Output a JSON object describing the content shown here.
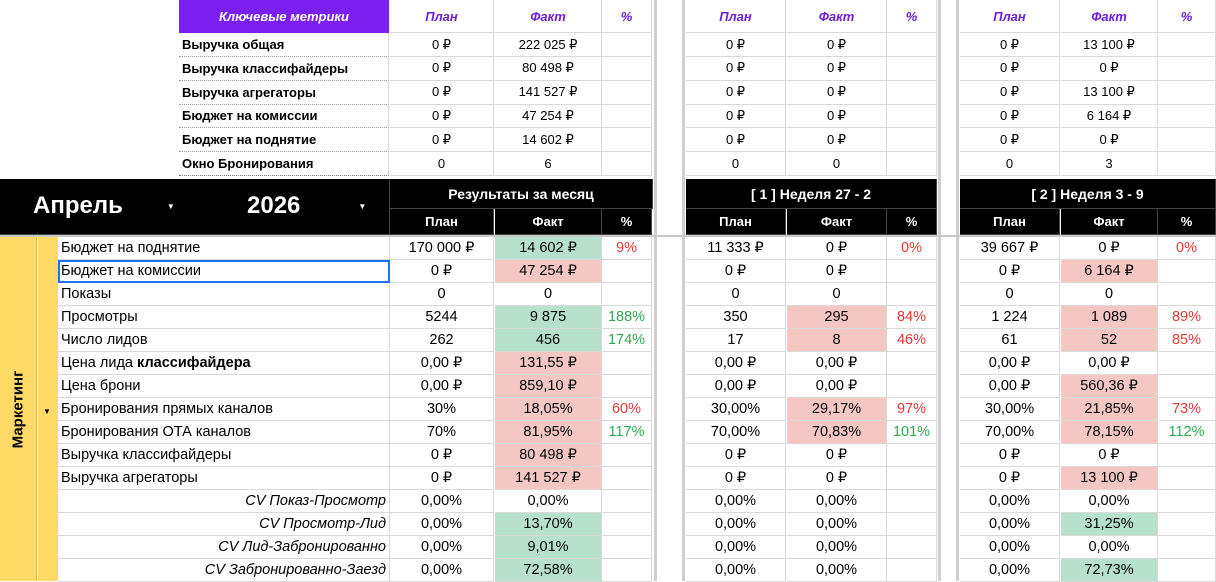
{
  "key_metrics": {
    "header": "Ключевые метрики",
    "col_plan": "План",
    "col_fact": "Факт",
    "col_pct": "%",
    "rows": [
      {
        "label": "Выручка общая",
        "m": [
          "0 ₽",
          "222 025 ₽",
          ""
        ],
        "w1": [
          "0 ₽",
          "0 ₽",
          ""
        ],
        "w2": [
          "0 ₽",
          "13 100 ₽",
          ""
        ]
      },
      {
        "label": "Выручка классифайдеры",
        "m": [
          "0 ₽",
          "80 498 ₽",
          ""
        ],
        "w1": [
          "0 ₽",
          "0 ₽",
          ""
        ],
        "w2": [
          "0 ₽",
          "0 ₽",
          ""
        ]
      },
      {
        "label": "Выручка агрегаторы",
        "m": [
          "0 ₽",
          "141 527 ₽",
          ""
        ],
        "w1": [
          "0 ₽",
          "0 ₽",
          ""
        ],
        "w2": [
          "0 ₽",
          "13 100 ₽",
          ""
        ]
      },
      {
        "label": "Бюджет на комиссии",
        "m": [
          "0 ₽",
          "47 254 ₽",
          ""
        ],
        "w1": [
          "0 ₽",
          "0 ₽",
          ""
        ],
        "w2": [
          "0 ₽",
          "6 164 ₽",
          ""
        ]
      },
      {
        "label": "Бюджет на поднятие",
        "m": [
          "0 ₽",
          "14 602 ₽",
          ""
        ],
        "w1": [
          "0 ₽",
          "0 ₽",
          ""
        ],
        "w2": [
          "0 ₽",
          "0 ₽",
          ""
        ]
      },
      {
        "label": "Окно Бронирования",
        "m": [
          "0",
          "6",
          ""
        ],
        "w1": [
          "0",
          "0",
          ""
        ],
        "w2": [
          "0",
          "3",
          ""
        ]
      }
    ]
  },
  "selectors": {
    "month": "Апрель",
    "year": "2026"
  },
  "periods": {
    "month": "Результаты за месяц",
    "w1": "[ 1 ] Неделя 27 - 2",
    "w2": "[ 2 ] Неделя 3 - 9"
  },
  "section": {
    "label": "Маркетинг"
  },
  "marketing_rows": [
    {
      "label": "Бюджет на поднятие",
      "m": [
        "170 000 ₽",
        "14 602 ₽",
        "9%"
      ],
      "mf": "green",
      "mp": "red",
      "w1": [
        "11 333 ₽",
        "0 ₽",
        "0%"
      ],
      "w1f": "",
      "w1p": "red",
      "w2": [
        "39 667 ₽",
        "0 ₽",
        "0%"
      ],
      "w2f": "",
      "w2p": "red"
    },
    {
      "label": "Бюджет на комиссии",
      "m": [
        "0 ₽",
        "47 254 ₽",
        ""
      ],
      "mf": "red",
      "mp": "",
      "w1": [
        "0 ₽",
        "0 ₽",
        ""
      ],
      "w1f": "",
      "w1p": "",
      "w2": [
        "0 ₽",
        "6 164 ₽",
        ""
      ],
      "w2f": "red",
      "w2p": ""
    },
    {
      "label": "Показы",
      "m": [
        "0",
        "0",
        ""
      ],
      "mf": "",
      "mp": "",
      "w1": [
        "0",
        "0",
        ""
      ],
      "w1f": "",
      "w1p": "",
      "w2": [
        "0",
        "0",
        ""
      ],
      "w2f": "",
      "w2p": ""
    },
    {
      "label": "Просмотры",
      "m": [
        "5244",
        "9 875",
        "188%"
      ],
      "mf": "green",
      "mp": "green",
      "w1": [
        "350",
        "295",
        "84%"
      ],
      "w1f": "red",
      "w1p": "red",
      "w2": [
        "1 224",
        "1 089",
        "89%"
      ],
      "w2f": "red",
      "w2p": "red"
    },
    {
      "label": "Число лидов",
      "m": [
        "262",
        "456",
        "174%"
      ],
      "mf": "green",
      "mp": "green",
      "w1": [
        "17",
        "8",
        "46%"
      ],
      "w1f": "red",
      "w1p": "red",
      "w2": [
        "61",
        "52",
        "85%"
      ],
      "w2f": "red",
      "w2p": "red"
    },
    {
      "label": "Цена лида ",
      "label_bold": "классифайдера",
      "m": [
        "0,00 ₽",
        "131,55 ₽",
        ""
      ],
      "mf": "red",
      "mp": "",
      "w1": [
        "0,00 ₽",
        "0,00 ₽",
        ""
      ],
      "w1f": "",
      "w1p": "",
      "w2": [
        "0,00 ₽",
        "0,00 ₽",
        ""
      ],
      "w2f": "",
      "w2p": ""
    },
    {
      "label": "Цена брони",
      "m": [
        "0,00 ₽",
        "859,10 ₽",
        ""
      ],
      "mf": "red",
      "mp": "",
      "w1": [
        "0,00 ₽",
        "0,00 ₽",
        ""
      ],
      "w1f": "",
      "w1p": "",
      "w2": [
        "0,00 ₽",
        "560,36 ₽",
        ""
      ],
      "w2f": "red",
      "w2p": ""
    },
    {
      "label": "Бронирования прямых каналов",
      "m": [
        "30%",
        "18,05%",
        "60%"
      ],
      "mf": "red",
      "mp": "red",
      "w1": [
        "30,00%",
        "29,17%",
        "97%"
      ],
      "w1f": "red",
      "w1p": "red",
      "w2": [
        "30,00%",
        "21,85%",
        "73%"
      ],
      "w2f": "red",
      "w2p": "red"
    },
    {
      "label": "Бронирования ОТА каналов",
      "m": [
        "70%",
        "81,95%",
        "117%"
      ],
      "mf": "red",
      "mp": "green",
      "w1": [
        "70,00%",
        "70,83%",
        "101%"
      ],
      "w1f": "red",
      "w1p": "green",
      "w2": [
        "70,00%",
        "78,15%",
        "112%"
      ],
      "w2f": "red",
      "w2p": "green"
    },
    {
      "label": "Выручка классифайдеры",
      "m": [
        "0 ₽",
        "80 498 ₽",
        ""
      ],
      "mf": "red",
      "mp": "",
      "w1": [
        "0 ₽",
        "0 ₽",
        ""
      ],
      "w1f": "",
      "w1p": "",
      "w2": [
        "0 ₽",
        "0 ₽",
        ""
      ],
      "w2f": "",
      "w2p": ""
    },
    {
      "label": "Выручка агрегаторы",
      "m": [
        "0 ₽",
        "141 527 ₽",
        ""
      ],
      "mf": "red",
      "mp": "",
      "w1": [
        "0 ₽",
        "0 ₽",
        ""
      ],
      "w1f": "",
      "w1p": "",
      "w2": [
        "0 ₽",
        "13 100 ₽",
        ""
      ],
      "w2f": "red",
      "w2p": ""
    },
    {
      "label": "CV Показ-Просмотр",
      "italic": true,
      "m": [
        "0,00%",
        "0,00%",
        ""
      ],
      "mf": "",
      "mp": "",
      "w1": [
        "0,00%",
        "0,00%",
        ""
      ],
      "w1f": "",
      "w1p": "",
      "w2": [
        "0,00%",
        "0,00%",
        ""
      ],
      "w2f": "",
      "w2p": ""
    },
    {
      "label": "CV Просмотр-Лид",
      "italic": true,
      "m": [
        "0,00%",
        "13,70%",
        ""
      ],
      "mf": "green",
      "mp": "",
      "w1": [
        "0,00%",
        "0,00%",
        ""
      ],
      "w1f": "",
      "w1p": "",
      "w2": [
        "0,00%",
        "31,25%",
        ""
      ],
      "w2f": "green",
      "w2p": ""
    },
    {
      "label": "CV Лид-Забронированно",
      "italic": true,
      "m": [
        "0,00%",
        "9,01%",
        ""
      ],
      "mf": "green",
      "mp": "",
      "w1": [
        "0,00%",
        "0,00%",
        ""
      ],
      "w1f": "",
      "w1p": "",
      "w2": [
        "0,00%",
        "0,00%",
        ""
      ],
      "w2f": "",
      "w2p": ""
    },
    {
      "label": "CV Забронированно-Заезд",
      "italic": true,
      "m": [
        "0,00%",
        "72,58%",
        ""
      ],
      "mf": "green",
      "mp": "",
      "w1": [
        "0,00%",
        "0,00%",
        ""
      ],
      "w1f": "",
      "w1p": "",
      "w2": [
        "0,00%",
        "72,73%",
        ""
      ],
      "w2f": "green",
      "w2p": ""
    }
  ]
}
